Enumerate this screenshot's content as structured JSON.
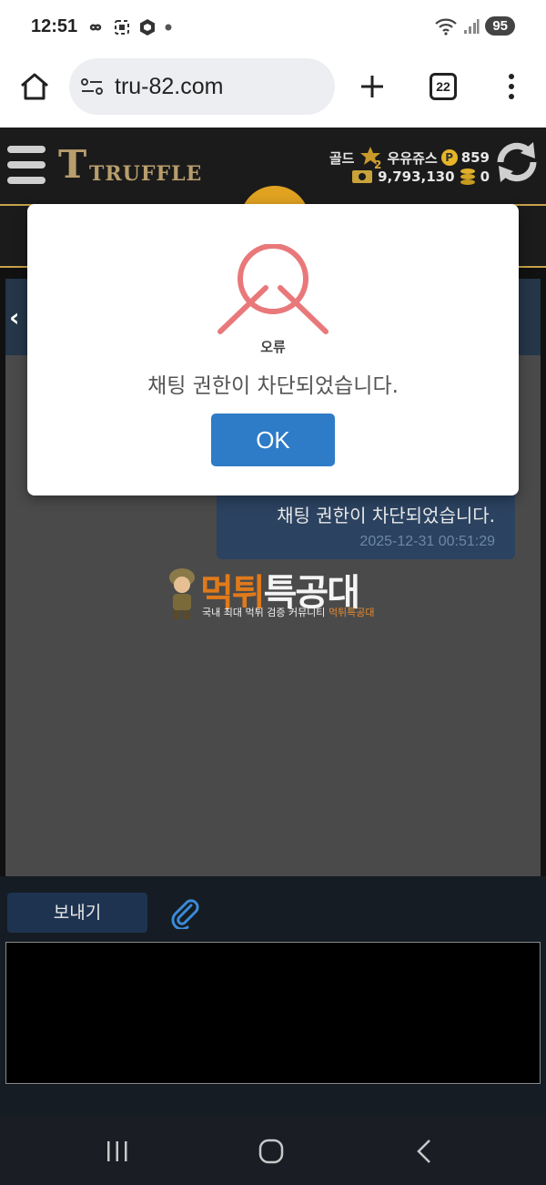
{
  "status_bar": {
    "time": "12:51",
    "battery": "95"
  },
  "browser": {
    "url": "tru-82.com",
    "tab_count": "22"
  },
  "site": {
    "logo": "TRUFFLE",
    "user_rank": "골드",
    "rank_number": "2",
    "username": "우유쥬스",
    "points_label": "P",
    "points": "859",
    "money": "9,793,130",
    "coins": "0"
  },
  "chat": {
    "message_text": "채팅 권한이 차단되었습니다.",
    "message_time": "2025-12-31 00:51:29",
    "send_label": "보내기"
  },
  "watermark": {
    "title_a": "먹튀",
    "title_b": "특공대",
    "sub_text": "국내 최대 먹튀 검증 커뮤니티 ",
    "sub_highlight": "먹튀특공대"
  },
  "modal": {
    "title": "오류",
    "text": "채팅 권한이 차단되었습니다.",
    "ok_label": "OK"
  },
  "colors": {
    "modal_ok": "#2e7bc7",
    "error_icon": "#e9787a",
    "gold_accent": "#c8a34a"
  }
}
